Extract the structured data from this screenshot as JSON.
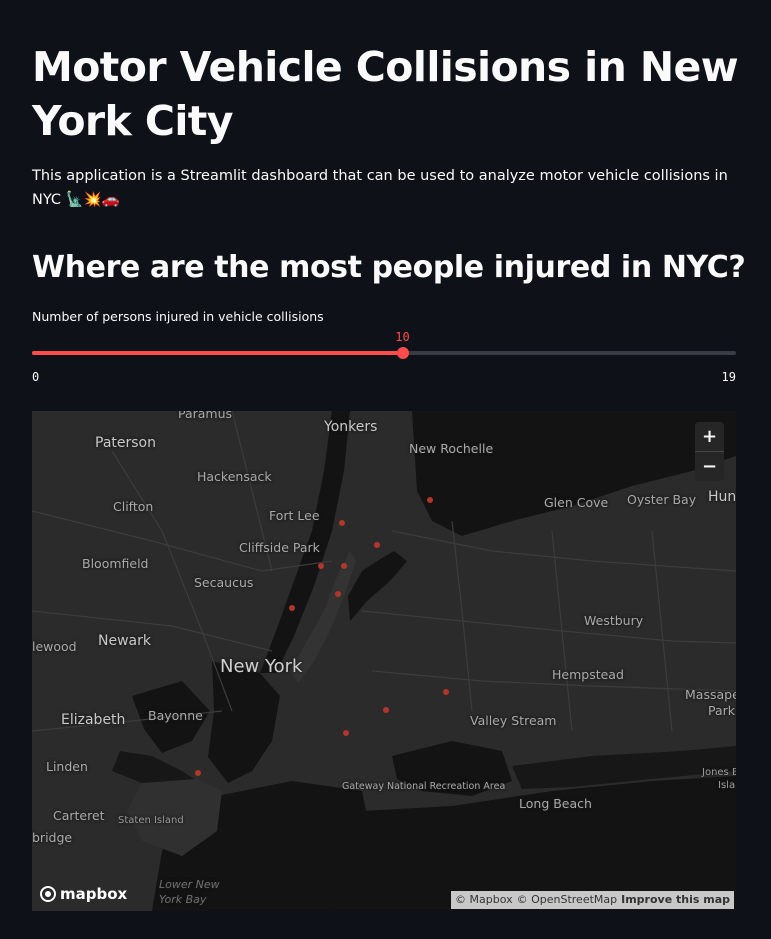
{
  "header": {
    "title": "Motor Vehicle Collisions in New York City",
    "description": "This application is a Streamlit dashboard that can be used to analyze motor vehicle collisions in NYC 🗽💥🚗"
  },
  "section": {
    "title": "Where are the most people injured in NYC?"
  },
  "slider": {
    "label": "Number of persons injured in vehicle collisions",
    "value": 10,
    "value_text": "10",
    "min": 0,
    "min_text": "0",
    "max": 19,
    "max_text": "19",
    "accent_color": "#ff4b4b"
  },
  "map": {
    "labels": {
      "paramus": "Paramus",
      "yonkers": "Yonkers",
      "paterson": "Paterson",
      "new_rochelle": "New Rochelle",
      "hackensack": "Hackensack",
      "clifton": "Clifton",
      "fort_lee": "Fort Lee",
      "glen_cove": "Glen Cove",
      "oyster_bay": "Oyster Bay",
      "hun": "Hun",
      "cliffside_park": "Cliffside Park",
      "bloomfield": "Bloomfield",
      "secaucus": "Secaucus",
      "westbury": "Westbury",
      "newark": "Newark",
      "lewood": "lewood",
      "new_york": "New York",
      "hempstead": "Hempstead",
      "elizabeth": "Elizabeth",
      "bayonne": "Bayonne",
      "valley_stream": "Valley Stream",
      "massape": "Massape",
      "park": "Park",
      "linden": "Linden",
      "gateway": "Gateway National Recreation Area",
      "jones_b": "Jones B",
      "isla": "Isla",
      "long_beach": "Long Beach",
      "carteret": "Carteret",
      "staten_island": "Staten Island",
      "bridge": "bridge",
      "lower_ny_bay": "Lower New York Bay"
    },
    "zoom_in": "+",
    "zoom_out": "−",
    "logo_text": "mapbox",
    "attribution": {
      "mapbox": "© Mapbox",
      "osm": "© OpenStreetMap",
      "improve": "Improve this map"
    },
    "dot_color": "#b3362b",
    "land_color": "#2b2b2b",
    "water_color": "#131313"
  }
}
